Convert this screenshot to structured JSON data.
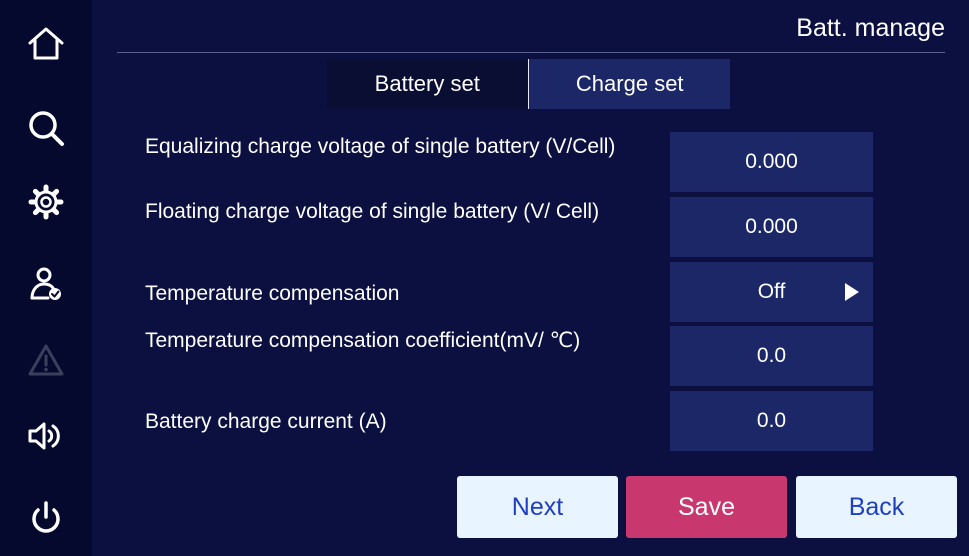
{
  "header": {
    "title": "Batt. manage"
  },
  "tabs": [
    {
      "label": "Battery set",
      "active": false
    },
    {
      "label": "Charge set",
      "active": true
    }
  ],
  "settings": [
    {
      "label": "Equalizing charge voltage of single battery (V/Cell)",
      "value": "0.000"
    },
    {
      "label": "Floating charge voltage of single battery (V/ Cell)",
      "value": "0.000"
    },
    {
      "label": "Temperature compensation",
      "value": "Off"
    },
    {
      "label": "Temperature compensation coefficient(mV/ ℃)",
      "value": "0.0"
    },
    {
      "label": "Battery charge current (A)",
      "value": "0.0"
    }
  ],
  "buttons": {
    "next": "Next",
    "save": "Save",
    "back": "Back"
  },
  "sidebar": {
    "items": [
      {
        "icon": "home-icon"
      },
      {
        "icon": "search-icon"
      },
      {
        "icon": "gear-icon"
      },
      {
        "icon": "user-check-icon"
      },
      {
        "icon": "warning-icon",
        "disabled": true
      },
      {
        "icon": "speaker-icon"
      },
      {
        "icon": "power-icon"
      }
    ]
  },
  "colors": {
    "background": "#0b1040",
    "sidebar": "#05092e",
    "field": "#1b2767",
    "save_button": "#c8376e",
    "light_button": "#e8f4ff",
    "light_button_text": "#1f3fbf"
  }
}
